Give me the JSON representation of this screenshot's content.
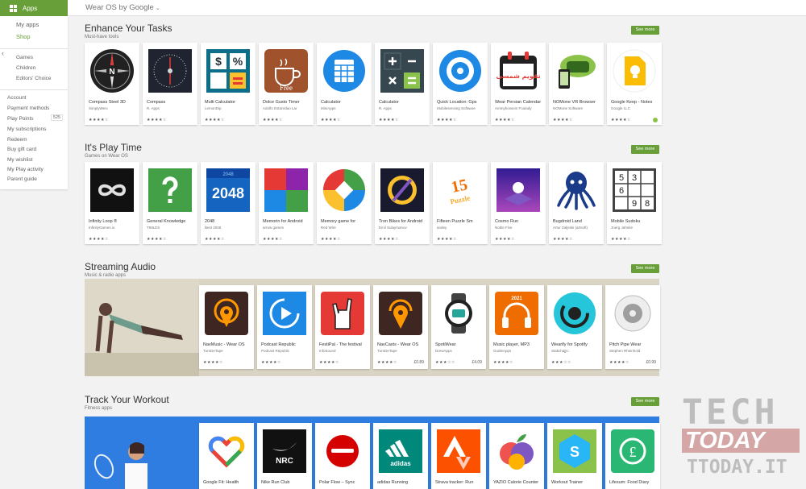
{
  "nav": {
    "apps_label": "Apps",
    "items": {
      "my_apps": "My apps",
      "shop": "Shop",
      "games": "Games",
      "children": "Children",
      "editors_choice": "Editors' Choice",
      "account": "Account",
      "payment_methods": "Payment methods",
      "play_points": "Play Points",
      "play_points_count": "525",
      "my_subscriptions": "My subscriptions",
      "redeem": "Redeem",
      "buy_gift_card": "Buy gift card",
      "my_wishlist": "My wishlist",
      "my_play_activity": "My Play activity",
      "parent_guide": "Parent guide"
    },
    "colors": {
      "accent": "#689f38"
    }
  },
  "header": {
    "title": "Wear OS by Google"
  },
  "see_more_label": "See more",
  "sections": [
    {
      "title": "Enhance Your Tasks",
      "subtitle": "Must-have tools",
      "apps": [
        {
          "name": "Compass Steel 3D",
          "dev": "SimplyWerx",
          "stars": "★★★★☆"
        },
        {
          "name": "Compass",
          "dev": "R. Apps",
          "stars": "★★★★☆"
        },
        {
          "name": "Multi Calculator",
          "dev": "LemonDip",
          "stars": "★★★★☆"
        },
        {
          "name": "Dolce Gusto Timer",
          "dev": "Adolfo Estanislao Lar",
          "stars": "★★★★☆"
        },
        {
          "name": "Calculator",
          "dev": "MiniApps",
          "stars": "★★★★☆"
        },
        {
          "name": "Calculator",
          "dev": "R. Apps",
          "stars": "★★★★☆"
        },
        {
          "name": "Quick Location: Gps",
          "dev": "Mobilesensing Software",
          "stars": "★★★★☆"
        },
        {
          "name": "Wear Persian Calendar",
          "dev": "Ammyhossein Foulady",
          "stars": "★★★★☆"
        },
        {
          "name": "NOMone VR Browser",
          "dev": "NOMone Software",
          "stars": "★★★★☆"
        },
        {
          "name": "Google Keep - Notes",
          "dev": "Google LLC",
          "stars": "★★★★☆"
        }
      ]
    },
    {
      "title": "It's Play Time",
      "subtitle": "Games on Wear OS",
      "apps": [
        {
          "name": "Infinity Loop ®",
          "dev": "InfinityGames.io",
          "stars": "★★★★☆"
        },
        {
          "name": "General Knowledge",
          "dev": "TIMLES",
          "stars": "★★★★☆"
        },
        {
          "name": "2048",
          "dev": "Best 2048",
          "stars": "★★★★☆"
        },
        {
          "name": "Memorin for Android",
          "dev": "arrow games",
          "stars": "★★★★☆"
        },
        {
          "name": "Memory game for",
          "dev": "Red Wire",
          "stars": "★★★★☆"
        },
        {
          "name": "Tron Bikes for Android",
          "dev": "Emil Sulaymanov",
          "stars": "★★★★☆"
        },
        {
          "name": "Fifteen Puzzle Sm",
          "dev": "andey",
          "stars": "★★★★☆"
        },
        {
          "name": "Cosmo Run",
          "dev": "Noble Five",
          "stars": "★★★★☆"
        },
        {
          "name": "Bugdroid Land",
          "dev": "Artur Zaljeski (artsoft)",
          "stars": "★★★★☆"
        },
        {
          "name": "Mobile Sudoku",
          "dev": "Joerg Jahnke",
          "stars": "★★★★☆"
        }
      ]
    },
    {
      "title": "Streaming Audio",
      "subtitle": "Music & radio apps",
      "apps": [
        {
          "name": "NavMusic - Wear OS",
          "dev": "TurnDeTape",
          "stars": "★★★★☆",
          "price": ""
        },
        {
          "name": "Podcast Republic",
          "dev": "Podcast Republic",
          "stars": "★★★★☆",
          "price": ""
        },
        {
          "name": "FestiPal - The festival",
          "dev": "InfoSound",
          "stars": "★★★★☆",
          "price": ""
        },
        {
          "name": "NavCasts - Wear OS",
          "dev": "TurnDeTape",
          "stars": "★★★★☆",
          "price": "£0.89"
        },
        {
          "name": "SpotiWear",
          "dev": "DrewApps",
          "stars": "★★★☆☆",
          "price": "£4.09"
        },
        {
          "name": "Music player, MP3",
          "dev": "GuideApps",
          "stars": "★★★★☆",
          "price": ""
        },
        {
          "name": "Wearify for Spotify",
          "dev": "Stakchajjic",
          "stars": "★★★☆☆",
          "price": ""
        },
        {
          "name": "Pitch Pipe Wear",
          "dev": "Stephen Rheinhold",
          "stars": "★★★★☆",
          "price": "£0.99"
        }
      ]
    },
    {
      "title": "Track Your Workout",
      "subtitle": "Fitness apps",
      "apps": [
        {
          "name": "Google Fit: Health",
          "dev": "",
          "stars": ""
        },
        {
          "name": "Nike Run Club",
          "dev": "",
          "stars": ""
        },
        {
          "name": "Polar Flow – Sync",
          "dev": "",
          "stars": ""
        },
        {
          "name": "adidas Running",
          "dev": "",
          "stars": ""
        },
        {
          "name": "Strava tracker: Run",
          "dev": "",
          "stars": ""
        },
        {
          "name": "YAZIO Calorie Counter",
          "dev": "",
          "stars": ""
        },
        {
          "name": "Workout Trainer",
          "dev": "",
          "stars": ""
        },
        {
          "name": "Lifesum: Food Diary",
          "dev": "",
          "stars": ""
        }
      ]
    }
  ],
  "icon_text": {
    "compass_n": "N",
    "multicalc_top": "$",
    "multicalc_pct": "%",
    "dolce": "Free",
    "persian": "تقویم شمسی",
    "g2048": "2048",
    "g2048_top": "2048",
    "puzzle": "15",
    "puzzle_small": "Puzzle",
    "sudoku": [
      "5",
      "3",
      "",
      "6",
      "",
      "",
      "",
      "9",
      "8"
    ],
    "music_year": "2021",
    "nrc": "NRC",
    "adidas": "adidas"
  },
  "watermark": {
    "line1": "TECH",
    "line2": "TODAY",
    "line3": "TTODAY.IT"
  }
}
